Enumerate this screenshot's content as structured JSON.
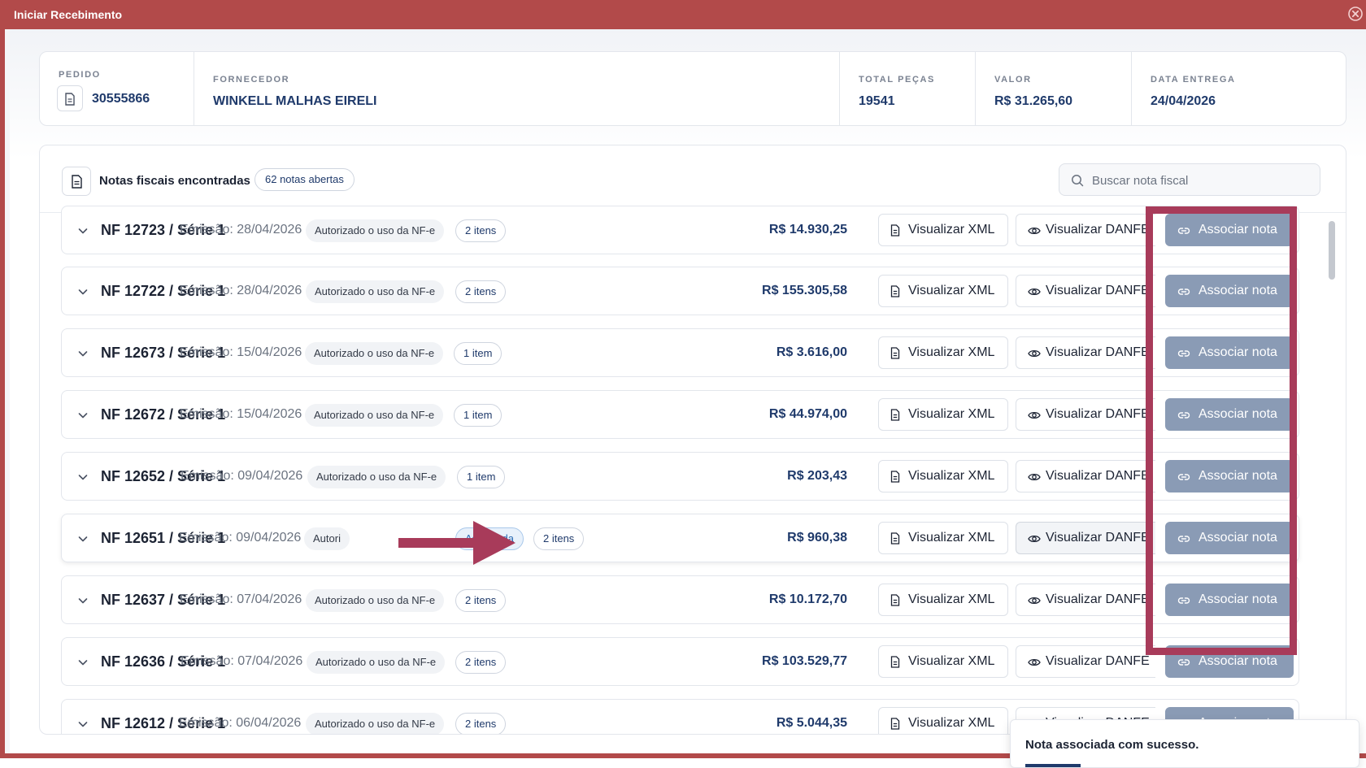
{
  "window": {
    "title": "Iniciar Recebimento"
  },
  "summary": {
    "pedido": {
      "label": "PEDIDO",
      "value": "30555866"
    },
    "fornecedor": {
      "label": "FORNECEDOR",
      "value": "WINKELL MALHAS EIRELI"
    },
    "total_pecas": {
      "label": "TOTAL PEÇAS",
      "value": "19541"
    },
    "valor": {
      "label": "VALOR",
      "value": "R$ 31.265,60"
    },
    "data_entrega": {
      "label": "DATA ENTREGA",
      "value": "24/04/2026"
    }
  },
  "panel": {
    "title": "Notas fiscais encontradas",
    "badge": "62 notas abertas",
    "search_placeholder": "Buscar nota fiscal"
  },
  "buttons": {
    "xml": "Visualizar XML",
    "danfe": "Visualizar DANFE",
    "associar": "Associar nota"
  },
  "notes": [
    {
      "nf": "NF 12723 / Série 1",
      "emissao": "Emissão: 28/04/2026",
      "status": "Autorizado o uso da NF-e",
      "itens": "2 itens",
      "valor": "R$ 14.930,25"
    },
    {
      "nf": "NF 12722 / Série 1",
      "emissao": "Emissão: 28/04/2026",
      "status": "Autorizado o uso da NF-e",
      "itens": "2 itens",
      "valor": "R$ 155.305,58"
    },
    {
      "nf": "NF 12673 / Série 1",
      "emissao": "Emissão: 15/04/2026",
      "status": "Autorizado o uso da NF-e",
      "itens": "1 item",
      "valor": "R$ 3.616,00"
    },
    {
      "nf": "NF 12672 / Série 1",
      "emissao": "Emissão: 15/04/2026",
      "status": "Autorizado o uso da NF-e",
      "itens": "1 item",
      "valor": "R$ 44.974,00"
    },
    {
      "nf": "NF 12652 / Série 1",
      "emissao": "Emissão: 09/04/2026",
      "status": "Autorizado o uso da NF-e",
      "itens": "1 item",
      "valor": "R$ 203,43"
    },
    {
      "nf": "NF 12651 / Série 1",
      "emissao": "Emissão: 09/04/2026",
      "status": "Autori",
      "associada": "Associada",
      "itens": "2 itens",
      "valor": "R$ 960,38"
    },
    {
      "nf": "NF 12637 / Série 1",
      "emissao": "Emissão: 07/04/2026",
      "status": "Autorizado o uso da NF-e",
      "itens": "2 itens",
      "valor": "R$ 10.172,70"
    },
    {
      "nf": "NF 12636 / Série 1",
      "emissao": "Emissão: 07/04/2026",
      "status": "Autorizado o uso da NF-e",
      "itens": "2 itens",
      "valor": "R$ 103.529,77"
    },
    {
      "nf": "NF 12612 / Série 1",
      "emissao": "Emissão: 06/04/2026",
      "status": "Autorizado o uso da NF-e",
      "itens": "2 itens",
      "valor": "R$ 5.044,35"
    }
  ],
  "toast": {
    "message": "Nota associada com sucesso."
  },
  "colors": {
    "title_bar": "#b24a4a",
    "highlight": "#a83b5a",
    "accent": "#1f3a6b",
    "assoc_button": "#8a9bb5"
  }
}
